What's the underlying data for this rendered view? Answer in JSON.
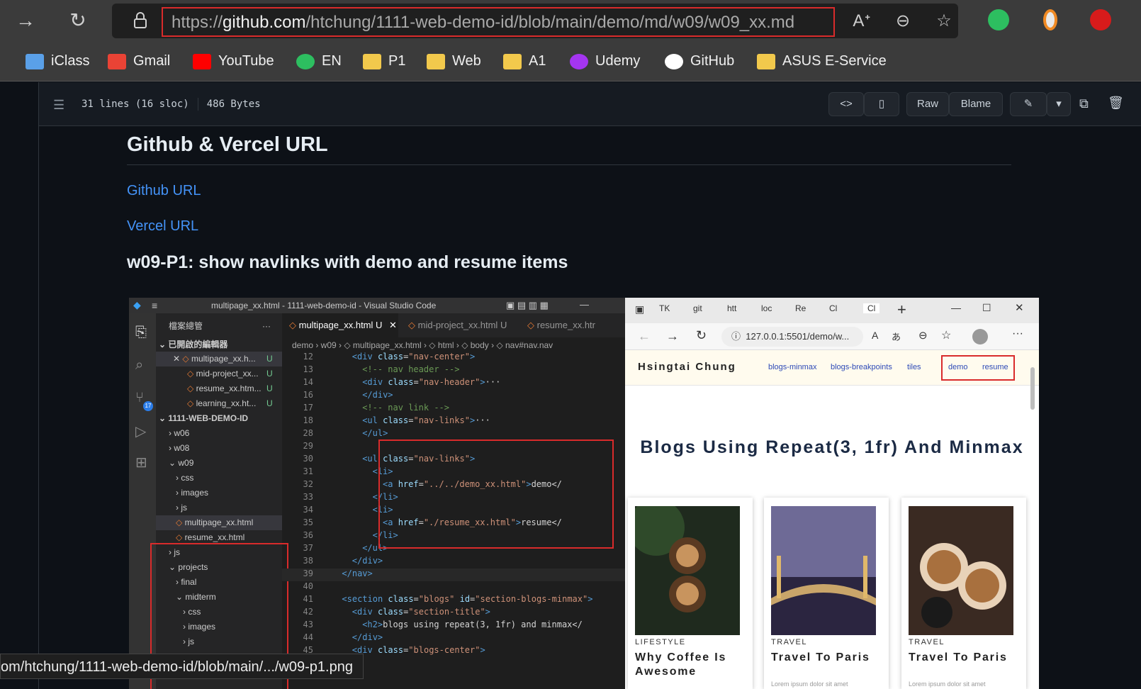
{
  "browser": {
    "url_prefix": "https://",
    "url_domain": "github.com",
    "url_path": "/htchung/1111-web-demo-id/blob/main/demo/md/w09/w09_xx.md"
  },
  "bookmarks": [
    {
      "label": "iClass",
      "icon": "iclass-icon"
    },
    {
      "label": "Gmail",
      "icon": "gmail-icon"
    },
    {
      "label": "YouTube",
      "icon": "youtube-icon"
    },
    {
      "label": "EN",
      "icon": "evernote-icon"
    },
    {
      "label": "P1",
      "icon": "folder-icon"
    },
    {
      "label": "Web",
      "icon": "folder-icon"
    },
    {
      "label": "A1",
      "icon": "folder-icon"
    },
    {
      "label": "Udemy",
      "icon": "udemy-icon"
    },
    {
      "label": "GitHub",
      "icon": "github-icon"
    },
    {
      "label": "ASUS E-Service",
      "icon": "folder-icon"
    }
  ],
  "file_header": {
    "lines": "31 lines (16 sloc)",
    "size": "486 Bytes",
    "raw": "Raw",
    "blame": "Blame"
  },
  "markdown": {
    "h1": "Github & Vercel URL",
    "link1": "Github URL",
    "link2": "Vercel URL",
    "h2": "w09-P1: show navlinks with demo and resume items"
  },
  "vscode": {
    "title": "multipage_xx.html - 1111-web-demo-id - Visual Studio Code",
    "explorer_title": "檔案總管",
    "open_editors": "已開啟的編輯器",
    "open_files": [
      "multipage_xx.h...",
      "mid-project_xx...",
      "resume_xx.htm...",
      "learning_xx.ht..."
    ],
    "repo": "1111-WEB-DEMO-ID",
    "tree": [
      {
        "label": "w06",
        "indent": 1,
        "arrow": "›"
      },
      {
        "label": "w08",
        "indent": 1,
        "arrow": "›"
      },
      {
        "label": "w09",
        "indent": 1,
        "arrow": "⌄"
      },
      {
        "label": "css",
        "indent": 2,
        "arrow": "›"
      },
      {
        "label": "images",
        "indent": 2,
        "arrow": "›"
      },
      {
        "label": "js",
        "indent": 2,
        "arrow": "›"
      },
      {
        "label": "multipage_xx.html",
        "indent": 2,
        "arrow": "◇"
      },
      {
        "label": "resume_xx.html",
        "indent": 2,
        "arrow": "◇"
      },
      {
        "label": "js",
        "indent": 1,
        "arrow": "›"
      },
      {
        "label": "projects",
        "indent": 1,
        "arrow": "⌄"
      },
      {
        "label": "final",
        "indent": 2,
        "arrow": "›"
      },
      {
        "label": "midterm",
        "indent": 2,
        "arrow": "⌄"
      },
      {
        "label": "css",
        "indent": 3,
        "arrow": "›"
      },
      {
        "label": "images",
        "indent": 3,
        "arrow": "›"
      },
      {
        "label": "js",
        "indent": 3,
        "arrow": "›"
      }
    ],
    "tabs": [
      "multipage_xx.html",
      "mid-project_xx.html",
      "resume_xx.htr"
    ],
    "tab_status": "U",
    "breadcrumb": "demo › w09 › ◇ multipage_xx.html › ◇ html › ◇ body › ◇ nav#nav.nav",
    "code": [
      {
        "n": "12",
        "html": "<span class='tag'>&lt;div</span> <span class='attr'>class</span>=<span class='str'>\"nav-center\"</span><span class='tag'>&gt;</span>",
        "indent": 4
      },
      {
        "n": "13",
        "html": "<span class='cmt'>&lt;!-- nav header --&gt;</span>",
        "indent": 6
      },
      {
        "n": "14",
        "html": "<span class='tag'>&lt;div</span> <span class='attr'>class</span>=<span class='str'>\"nav-header\"</span><span class='tag'>&gt;</span>···",
        "indent": 6
      },
      {
        "n": "16",
        "html": "<span class='tag'>&lt;/div&gt;</span>",
        "indent": 6
      },
      {
        "n": "17",
        "html": "<span class='cmt'>&lt;!-- nav link --&gt;</span>",
        "indent": 6
      },
      {
        "n": "18",
        "html": "<span class='tag'>&lt;ul</span> <span class='attr'>class</span>=<span class='str'>\"nav-links\"</span><span class='tag'>&gt;</span>···",
        "indent": 6
      },
      {
        "n": "28",
        "html": "<span class='tag'>&lt;/ul&gt;</span>",
        "indent": 6
      },
      {
        "n": "29",
        "html": "",
        "indent": 0
      },
      {
        "n": "30",
        "html": "<span class='tag'>&lt;ul</span> <span class='attr'>class</span>=<span class='str'>\"nav-links\"</span><span class='tag'>&gt;</span>",
        "indent": 6
      },
      {
        "n": "31",
        "html": "<span class='tag'>&lt;li&gt;</span>",
        "indent": 8
      },
      {
        "n": "32",
        "html": "<span class='tag'>&lt;a</span> <span class='attr'>href</span>=<span class='str'>\"../../demo_xx.html\"</span><span class='tag'>&gt;</span>demo&lt;/",
        "indent": 10
      },
      {
        "n": "33",
        "html": "<span class='tag'>&lt;/li&gt;</span>",
        "indent": 8
      },
      {
        "n": "34",
        "html": "<span class='tag'>&lt;li&gt;</span>",
        "indent": 8
      },
      {
        "n": "35",
        "html": "<span class='tag'>&lt;a</span> <span class='attr'>href</span>=<span class='str'>\"./resume_xx.html\"</span><span class='tag'>&gt;</span>resume&lt;/",
        "indent": 10
      },
      {
        "n": "36",
        "html": "<span class='tag'>&lt;/li&gt;</span>",
        "indent": 8
      },
      {
        "n": "37",
        "html": "<span class='tag'>&lt;/ul&gt;</span>",
        "indent": 6
      },
      {
        "n": "38",
        "html": "<span class='tag'>&lt;/div&gt;</span>",
        "indent": 4
      },
      {
        "n": "39",
        "html": "<span class='tag'>&lt;/nav&gt;</span>",
        "indent": 2
      },
      {
        "n": "40",
        "html": "",
        "indent": 0
      },
      {
        "n": "41",
        "html": "<span class='tag'>&lt;section</span> <span class='attr'>class</span>=<span class='str'>\"blogs\"</span> <span class='attr'>id</span>=<span class='str'>\"section-blogs-minmax\"</span><span class='tag'>&gt;</span>",
        "indent": 2
      },
      {
        "n": "42",
        "html": "<span class='tag'>&lt;div</span> <span class='attr'>class</span>=<span class='str'>\"section-title\"</span><span class='tag'>&gt;</span>",
        "indent": 4
      },
      {
        "n": "43",
        "html": "<span class='tag'>&lt;h2&gt;</span>blogs using repeat(3, 1fr) and minmax&lt;/",
        "indent": 6
      },
      {
        "n": "44",
        "html": "<span class='tag'>&lt;/div&gt;</span>",
        "indent": 4
      },
      {
        "n": "45",
        "html": "<span class='tag'>&lt;div</span> <span class='attr'>class</span>=<span class='str'>\"blogs-center\"</span><span class='tag'>&gt;</span>",
        "indent": 4
      }
    ]
  },
  "preview": {
    "tabs": [
      "TK",
      "git",
      "htt",
      "loc",
      "Re",
      "Cl",
      "Cl"
    ],
    "url": "127.0.0.1:5501/demo/w...",
    "brand": "Hsingtai Chung",
    "nav_links": [
      "blogs-minmax",
      "blogs-breakpoints",
      "tiles",
      "demo",
      "resume"
    ],
    "heading": "Blogs Using Repeat(3, 1fr) And Minmax",
    "cards": [
      {
        "category": "LIFESTYLE",
        "title": "Why Coffee Is Awesome"
      },
      {
        "category": "TRAVEL",
        "title": "Travel To Paris"
      },
      {
        "category": "TRAVEL",
        "title": "Travel To Paris"
      }
    ],
    "lorem": "Lorem ipsum dolor sit amet"
  },
  "status_link": "om/htchung/1111-web-demo-id/blob/main/.../w09-p1.png"
}
